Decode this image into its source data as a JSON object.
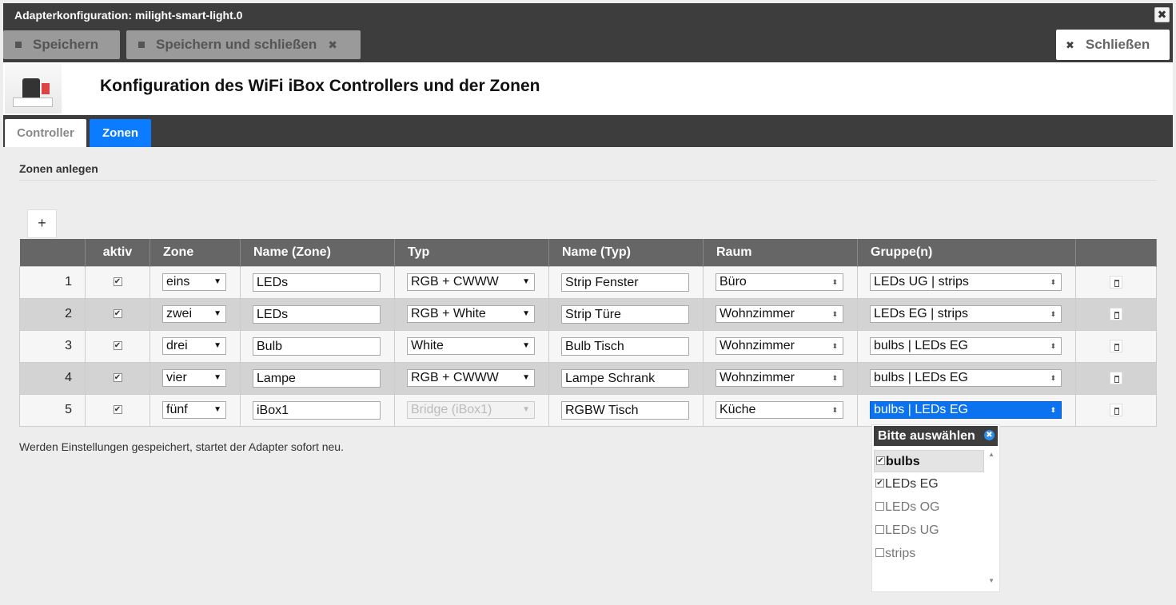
{
  "window": {
    "title": "Adapterkonfiguration: milight-smart-light.0",
    "close_glyph": "✖"
  },
  "toolbar": {
    "save_label": "Speichern",
    "save_close_label": "Speichern und schließen",
    "close_label": "Schließen"
  },
  "header": {
    "title": "Konfiguration des WiFi iBox Controllers und der Zonen"
  },
  "tabs": [
    {
      "label": "Controller"
    },
    {
      "label": "Zonen"
    }
  ],
  "section": {
    "title": "Zonen anlegen",
    "add_label": "+"
  },
  "table": {
    "headers": [
      "",
      "aktiv",
      "Zone",
      "Name (Zone)",
      "Typ",
      "Name (Typ)",
      "Raum",
      "Gruppe(n)",
      ""
    ],
    "rows": [
      {
        "num": "1",
        "active": "✔",
        "zone": "eins",
        "zone_name": "LEDs",
        "type": "RGB + CWWW",
        "type_name": "Strip Fenster",
        "room": "Büro",
        "groups": "LEDs UG | strips"
      },
      {
        "num": "2",
        "active": "✔",
        "zone": "zwei",
        "zone_name": "LEDs",
        "type": "RGB + White",
        "type_name": "Strip Türe",
        "room": "Wohnzimmer",
        "groups": "LEDs EG | strips"
      },
      {
        "num": "3",
        "active": "✔",
        "zone": "drei",
        "zone_name": "Bulb",
        "type": "White",
        "type_name": "Bulb Tisch",
        "room": "Wohnzimmer",
        "groups": "bulbs | LEDs EG"
      },
      {
        "num": "4",
        "active": "✔",
        "zone": "vier",
        "zone_name": "Lampe",
        "type": "RGB + CWWW",
        "type_name": "Lampe Schrank",
        "room": "Wohnzimmer",
        "groups": "bulbs | LEDs EG"
      },
      {
        "num": "5",
        "active": "✔",
        "zone": "fünf",
        "zone_name": "iBox1",
        "type": "Bridge (iBox1)",
        "type_name": "RGBW Tisch",
        "room": "Küche",
        "groups": "bulbs | LEDs EG"
      }
    ]
  },
  "footnote": "Werden Einstellungen gespeichert, startet der Adapter sofort neu.",
  "group_dropdown": {
    "header": "Bitte auswählen",
    "options": [
      {
        "label": "bulbs",
        "checked": "✔"
      },
      {
        "label": "LEDs EG",
        "checked": "✔"
      },
      {
        "label": "LEDs OG",
        "checked": ""
      },
      {
        "label": "LEDs UG",
        "checked": ""
      },
      {
        "label": "strips",
        "checked": ""
      }
    ]
  },
  "colors": {
    "accent": "#0b7cff",
    "dark_bar": "#3d3d3d",
    "header_row": "#666666"
  }
}
